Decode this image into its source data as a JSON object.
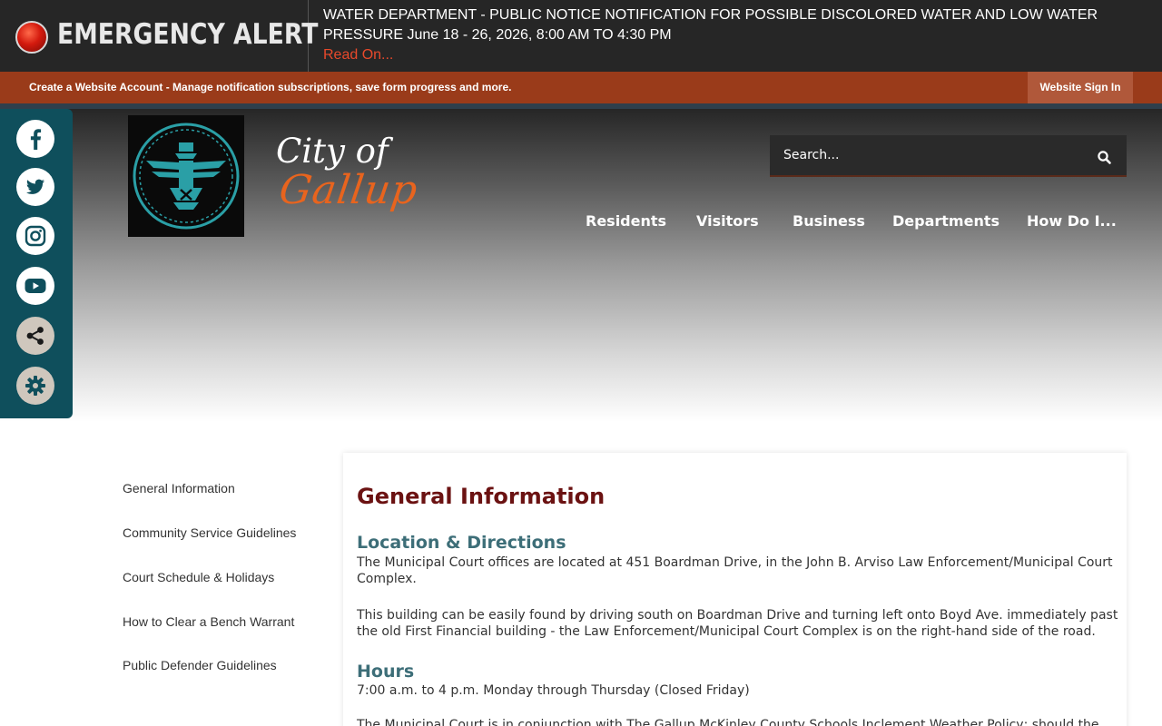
{
  "alert": {
    "label": "EMERGENCY ALERT",
    "message": "WATER DEPARTMENT - PUBLIC NOTICE NOTIFICATION FOR POSSIBLE DISCOLORED WATER AND LOW WATER PRESSURE June 18 - 26, 2026, 8:00 AM TO 4:30 PM",
    "read_on": "Read On..."
  },
  "account": {
    "create_text": "Create a Website Account - Manage notification subscriptions, save form progress and more.",
    "sign_in": "Website Sign In"
  },
  "social": {
    "items": [
      "facebook-icon",
      "twitter-icon",
      "instagram-icon",
      "youtube-icon",
      "share-icon",
      "gear-icon"
    ]
  },
  "brand": {
    "city_of": "City of",
    "name": "Gallup"
  },
  "search": {
    "placeholder": "Search..."
  },
  "nav": {
    "items": [
      "Residents",
      "Visitors",
      "Business",
      "Departments",
      "How Do I..."
    ]
  },
  "subnav": {
    "items": [
      "General Information",
      "Community Service Guidelines",
      "Court Schedule & Holidays",
      "How to Clear a Bench Warrant",
      "Public Defender Guidelines"
    ]
  },
  "content": {
    "title": "General Information",
    "location_heading": "Location & Directions",
    "location_p1": "The Municipal Court offices are located at 451 Boardman Drive, in the John B. Arviso Law Enforcement/Municipal Court Complex.",
    "location_p2": "This building can be easily found by driving south on Boardman Drive and turning left onto Boyd Ave. immediately past the old First Financial building - the Law Enforcement/Municipal Court Complex is on the right-hand side of the road.",
    "hours_heading": "Hours",
    "hours_p1": "7:00 a.m. to 4 p.m. Monday through Thursday (Closed Friday)",
    "hours_p2": "The Municipal Court is in conjunction with The Gallup McKinley County Schools Inclement Weather Policy; should the"
  },
  "colors": {
    "alert_bg": "#262626",
    "account_bar": "#9a3b1a",
    "social_bg": "#0f4f5c",
    "title": "#6b1212",
    "heading": "#3d6e78",
    "brand_orange": "#e8641e"
  }
}
